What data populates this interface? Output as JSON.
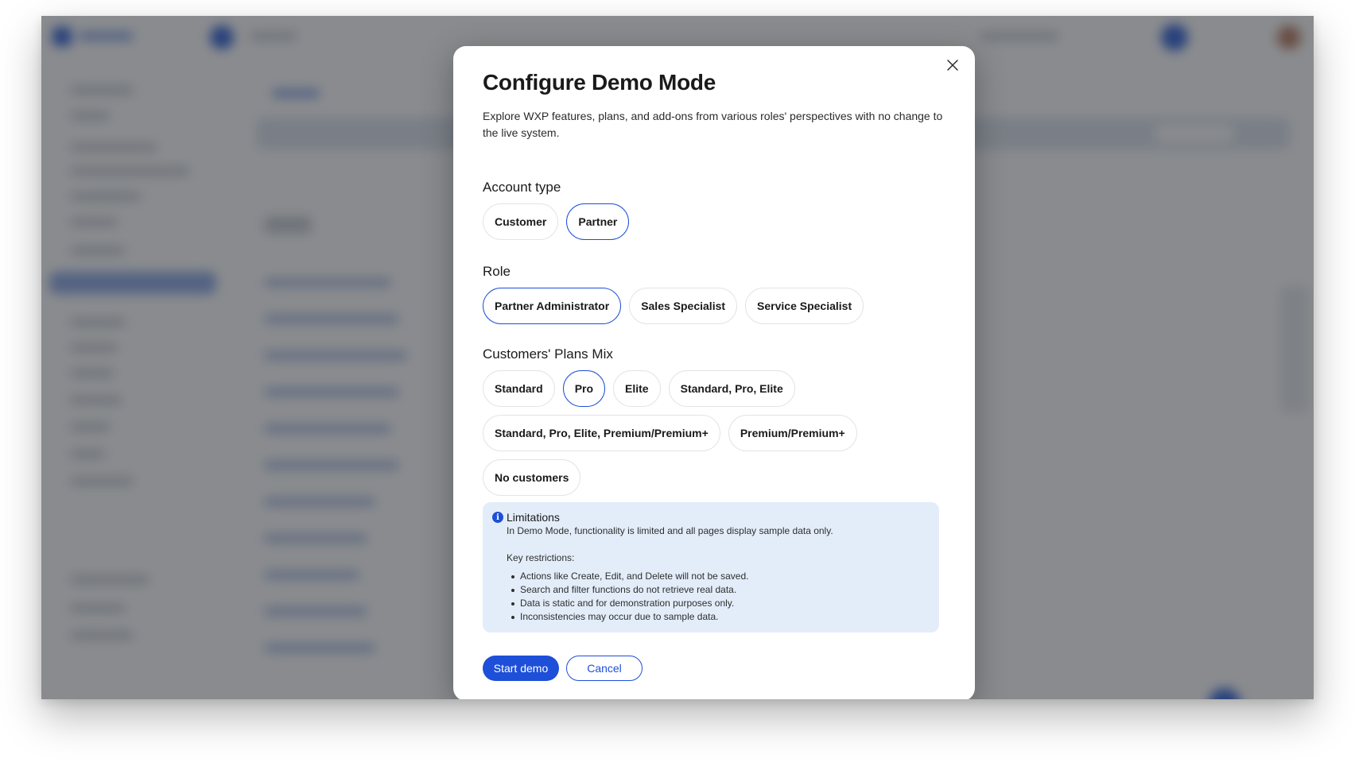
{
  "modal": {
    "title": "Configure Demo Mode",
    "description": "Explore WXP features, plans, and add-ons from various roles' perspectives with no change to the live system.",
    "close_icon": "close-icon"
  },
  "account_type": {
    "label": "Account type",
    "options": [
      "Customer",
      "Partner"
    ],
    "selected": "Partner"
  },
  "role": {
    "label": "Role",
    "options": [
      "Partner Administrator",
      "Sales Specialist",
      "Service Specialist"
    ],
    "selected": "Partner Administrator"
  },
  "plans_mix": {
    "label": "Customers' Plans Mix",
    "options": [
      "Standard",
      "Pro",
      "Elite",
      "Standard, Pro, Elite",
      "Standard, Pro, Elite, Premium/Premium+",
      "Premium/Premium+",
      "No customers"
    ],
    "selected": "Pro"
  },
  "limitations": {
    "icon": "info-icon",
    "title": "Limitations",
    "text": "In Demo Mode, functionality is limited and all pages display sample data only.",
    "restrictions_label": "Key restrictions:",
    "restrictions": [
      "Actions like Create, Edit, and Delete will not be saved.",
      "Search and filter functions do not retrieve real data.",
      "Data is static and for demonstration purposes only.",
      "Inconsistencies may occur due to sample data."
    ]
  },
  "actions": {
    "start_label": "Start demo",
    "cancel_label": "Cancel"
  },
  "colors": {
    "accent": "#1d4fd8",
    "info_background": "#e3edf9",
    "overlay": "#5a5e64"
  }
}
